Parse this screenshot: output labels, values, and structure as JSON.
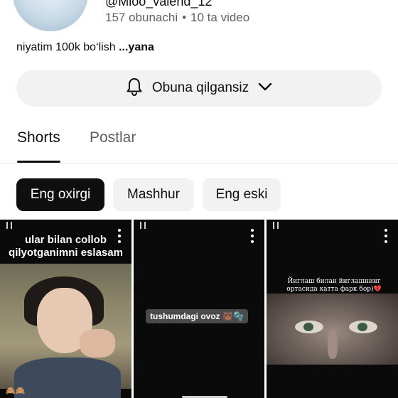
{
  "channel": {
    "handle": "@Mloo_valend_12",
    "subscribers": "157 obunachi",
    "separator": "•",
    "videos": "10 ta video",
    "description": "niyatim 100k bo‘lish",
    "more": "...yana"
  },
  "subscribe_button": {
    "label": "Obuna qilgansiz",
    "icon": "bell-icon",
    "chevron": "chevron-down-icon"
  },
  "tabs": [
    {
      "label": "Shorts",
      "active": true
    },
    {
      "label": "Postlar",
      "active": false
    }
  ],
  "filters": [
    {
      "label": "Eng oxirgi",
      "active": true
    },
    {
      "label": "Mashhur",
      "active": false
    },
    {
      "label": "Eng eski",
      "active": false
    }
  ],
  "shorts": [
    {
      "caption": "ular bilan collob qilyotganimni eslasam",
      "emoji": "🙈🙈"
    },
    {
      "caption": "tushumdagi ovoz 🐻🫧"
    },
    {
      "caption": "Йиглаш билан йиглашнинг ортасида катта фарк бор)💔"
    }
  ],
  "colors": {
    "text": "#0f0f0f",
    "muted": "#606060",
    "chip_bg": "#f2f2f2",
    "active_chip": "#0f0f0f"
  }
}
